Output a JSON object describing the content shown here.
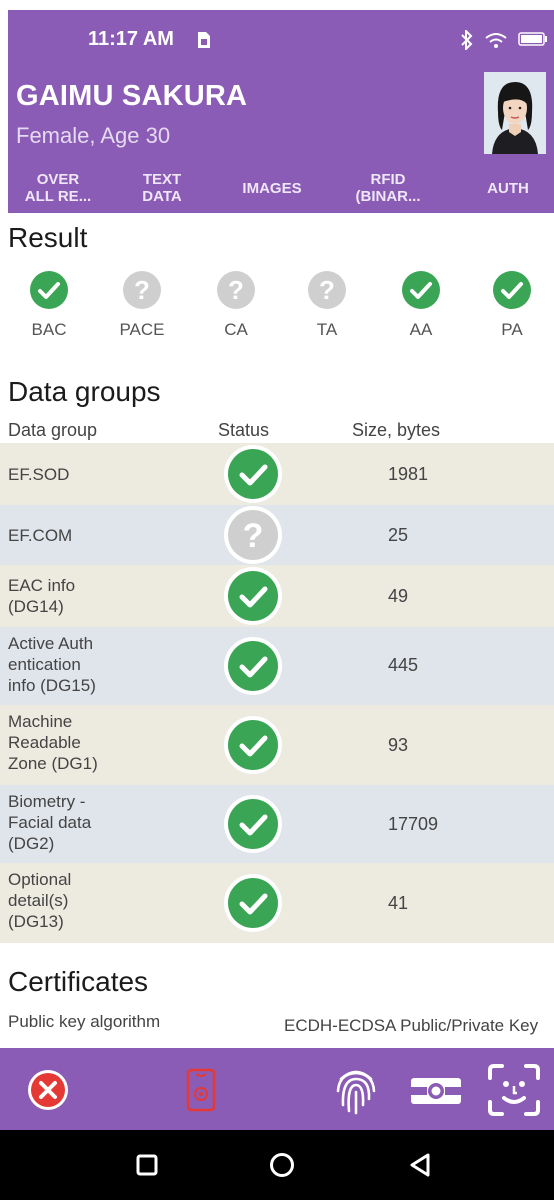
{
  "status_bar": {
    "time": "11:17 AM"
  },
  "header": {
    "name": "GAIMU SAKURA",
    "subtitle": "Female, Age 30",
    "tabs": [
      {
        "label": "OVER\nALL RE..."
      },
      {
        "label": "TEXT\nDATA"
      },
      {
        "label": "IMAGES"
      },
      {
        "label": "RFID\n(BINAR..."
      },
      {
        "label": "AUTH"
      }
    ]
  },
  "result": {
    "title": "Result",
    "items": [
      {
        "label": "BAC",
        "status": "ok"
      },
      {
        "label": "PACE",
        "status": "unknown"
      },
      {
        "label": "CA",
        "status": "unknown"
      },
      {
        "label": "TA",
        "status": "unknown"
      },
      {
        "label": "AA",
        "status": "ok"
      },
      {
        "label": "PA",
        "status": "ok"
      }
    ]
  },
  "data_groups": {
    "title": "Data groups",
    "columns": {
      "group": "Data group",
      "status": "Status",
      "size": "Size, bytes"
    },
    "rows": [
      {
        "label": "EF.SOD",
        "status": "ok",
        "size": "1981"
      },
      {
        "label": "EF.COM",
        "status": "unknown",
        "size": "25"
      },
      {
        "label": "EAC info\n(DG14)",
        "status": "ok",
        "size": "49"
      },
      {
        "label": "Active Auth\nentication\ninfo (DG15)",
        "status": "ok",
        "size": "445"
      },
      {
        "label": "Machine\nReadable\nZone (DG1)",
        "status": "ok",
        "size": "93"
      },
      {
        "label": "Biometry -\nFacial data\n(DG2)",
        "status": "ok",
        "size": "17709"
      },
      {
        "label": "Optional\ndetail(s)\n(DG13)",
        "status": "ok",
        "size": "41"
      }
    ]
  },
  "certificates": {
    "title": "Certificates",
    "key_label": "Public key algorithm",
    "key_value": "ECDH-ECDSA Public/Private Key"
  },
  "colors": {
    "primary": "#8a5cb5",
    "ok": "#3aa655",
    "unknown": "#cfcfcf",
    "close": "#e53935"
  },
  "toolbar": {
    "icons": [
      "close-icon",
      "rfid-card-icon",
      "fingerprint-icon",
      "document-camera-icon",
      "face-scan-icon"
    ]
  }
}
